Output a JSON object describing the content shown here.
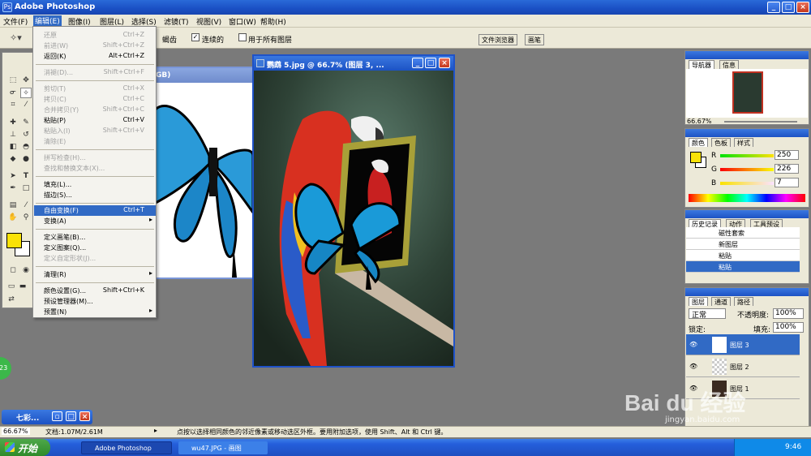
{
  "app": {
    "title": "Adobe Photoshop"
  },
  "menu": [
    "文件(F)",
    "编辑(E)",
    "图像(I)",
    "图层(L)",
    "选择(S)",
    "滤镜(T)",
    "视图(V)",
    "窗口(W)",
    "帮助(H)"
  ],
  "options": {
    "feather_tail": "蝎齿",
    "contiguous": "连续的",
    "all_layers": "用于所有图层",
    "file_browser": "文件浏览器",
    "brushes": "画笔"
  },
  "edit_menu": [
    {
      "label": "还原",
      "shortcut": "Ctrl+Z",
      "state": "disabled"
    },
    {
      "label": "前进(W)",
      "shortcut": "Shift+Ctrl+Z",
      "state": "disabled"
    },
    {
      "label": "返回(K)",
      "shortcut": "Alt+Ctrl+Z",
      "state": "enabled"
    },
    {
      "label": "消褪(D)...",
      "shortcut": "Shift+Ctrl+F",
      "state": "disabled"
    },
    {
      "label": "剪切(T)",
      "shortcut": "Ctrl+X",
      "state": "disabled"
    },
    {
      "label": "拷贝(C)",
      "shortcut": "Ctrl+C",
      "state": "disabled"
    },
    {
      "label": "合并拷贝(Y)",
      "shortcut": "Shift+Ctrl+C",
      "state": "disabled"
    },
    {
      "label": "粘贴(P)",
      "shortcut": "Ctrl+V",
      "state": "enabled"
    },
    {
      "label": "粘贴入(I)",
      "shortcut": "Shift+Ctrl+V",
      "state": "disabled"
    },
    {
      "label": "清除(E)",
      "shortcut": "",
      "state": "disabled"
    },
    {
      "label": "拼写检查(H)...",
      "shortcut": "",
      "state": "disabled"
    },
    {
      "label": "查找和替换文本(X)...",
      "shortcut": "",
      "state": "disabled"
    },
    {
      "label": "填充(L)...",
      "shortcut": "",
      "state": "enabled"
    },
    {
      "label": "描边(S)...",
      "shortcut": "",
      "state": "enabled"
    },
    {
      "label": "自由变换(F)",
      "shortcut": "Ctrl+T",
      "state": "highlighted"
    },
    {
      "label": "变换(A)",
      "shortcut": "",
      "state": "submenu"
    },
    {
      "label": "定义画笔(B)...",
      "shortcut": "",
      "state": "enabled"
    },
    {
      "label": "定义图案(Q)...",
      "shortcut": "",
      "state": "enabled"
    },
    {
      "label": "定义自定形状(J)...",
      "shortcut": "",
      "state": "disabled"
    },
    {
      "label": "清理(R)",
      "shortcut": "",
      "state": "submenu"
    },
    {
      "label": "颜色设置(G)...",
      "shortcut": "Shift+Ctrl+K",
      "state": "enabled"
    },
    {
      "label": "预设管理器(M)...",
      "shortcut": "",
      "state": "enabled"
    },
    {
      "label": "预置(N)",
      "shortcut": "",
      "state": "submenu"
    }
  ],
  "doc_main": {
    "title": "鹦鹉 5.jpg @ 66.7% (图层 3, ..."
  },
  "doc_bg": {
    "title_tail": "GB)"
  },
  "minimized": {
    "title": "七彩..."
  },
  "navigator": {
    "tab1": "导航器",
    "tab2": "信息",
    "zoom": "66.67%"
  },
  "color_panel": {
    "tab1": "颜色",
    "tab2": "色板",
    "tab3": "样式",
    "r_label": "R",
    "g_label": "G",
    "b_label": "B",
    "r": "250",
    "g": "226",
    "b": "7",
    "fg_color": "#fae207"
  },
  "history": {
    "tab1": "历史记录",
    "tab2": "动作",
    "tab3": "工具预设",
    "items": [
      "磁性套索",
      "新图层",
      "粘贴",
      "粘贴"
    ]
  },
  "layers": {
    "tab1": "图层",
    "tab2": "通道",
    "tab3": "路径",
    "blend": "正常",
    "opacity_label": "不透明度:",
    "opacity": "100%",
    "lock_label": "锁定:",
    "fill_label": "填充:",
    "fill": "100%",
    "items": [
      "图层 3",
      "图层 2",
      "图层 1"
    ]
  },
  "status": {
    "zoom": "66.67%",
    "doc": "文档:1.07M/2.61M",
    "hint": "点按以选择相同颜色的邻近像素或移动选区外框。要用附加选项，使用 Shift、Alt 和 Ctrl 键。"
  },
  "taskbar": {
    "start": "开始",
    "task1": "Adobe Photoshop",
    "task2": "wu47.JPG - 画图",
    "clock": "9:46"
  },
  "badge": "23",
  "watermark": {
    "logo": "Bai du 经验",
    "url": "jingyan.baidu.com"
  }
}
